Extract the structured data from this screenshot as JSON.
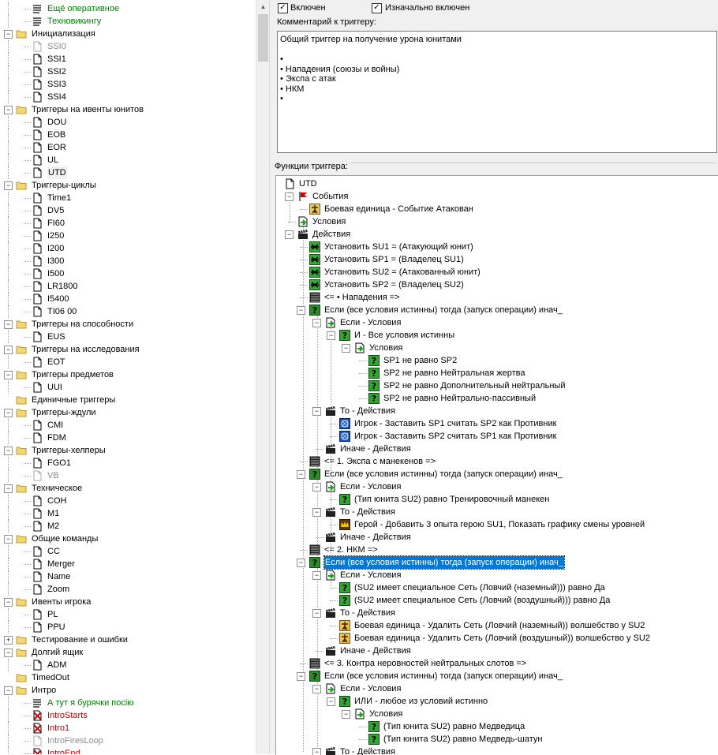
{
  "left_tree": [
    {
      "label": "Ещё оперативное",
      "level": 2,
      "icon": "comment",
      "color": "#008000"
    },
    {
      "label": "Техновикингу",
      "level": 2,
      "icon": "comment",
      "color": "#008000"
    },
    {
      "label": "Инициализация",
      "level": 1,
      "icon": "folder",
      "exp": "-"
    },
    {
      "label": "SSI0",
      "level": 2,
      "icon": "trigger-disabled",
      "color": "#8a8a8a"
    },
    {
      "label": "SSI1",
      "level": 2,
      "icon": "trigger"
    },
    {
      "label": "SSI2",
      "level": 2,
      "icon": "trigger"
    },
    {
      "label": "SSI3",
      "level": 2,
      "icon": "trigger"
    },
    {
      "label": "SSI4",
      "level": 2,
      "icon": "trigger"
    },
    {
      "label": "Триггеры на ивенты юнитов",
      "level": 1,
      "icon": "folder",
      "exp": "-"
    },
    {
      "label": "DOU",
      "level": 2,
      "icon": "trigger"
    },
    {
      "label": "EOB",
      "level": 2,
      "icon": "trigger"
    },
    {
      "label": "EOR",
      "level": 2,
      "icon": "trigger"
    },
    {
      "label": "UL",
      "level": 2,
      "icon": "trigger"
    },
    {
      "label": "UTD",
      "level": 2,
      "icon": "trigger",
      "current": true
    },
    {
      "label": "Триггеры-циклы",
      "level": 1,
      "icon": "folder",
      "exp": "-"
    },
    {
      "label": "Time1",
      "level": 2,
      "icon": "trigger"
    },
    {
      "label": "DV5",
      "level": 2,
      "icon": "trigger"
    },
    {
      "label": "FI60",
      "level": 2,
      "icon": "trigger"
    },
    {
      "label": "I250",
      "level": 2,
      "icon": "trigger"
    },
    {
      "label": "I200",
      "level": 2,
      "icon": "trigger"
    },
    {
      "label": "I300",
      "level": 2,
      "icon": "trigger"
    },
    {
      "label": "I500",
      "level": 2,
      "icon": "trigger"
    },
    {
      "label": "LR1800",
      "level": 2,
      "icon": "trigger"
    },
    {
      "label": "I5400",
      "level": 2,
      "icon": "trigger"
    },
    {
      "label": "TI06 00",
      "level": 2,
      "icon": "trigger"
    },
    {
      "label": "Триггеры на способности",
      "level": 1,
      "icon": "folder",
      "exp": "-"
    },
    {
      "label": "EUS",
      "level": 2,
      "icon": "trigger"
    },
    {
      "label": "Триггеры на исследования",
      "level": 1,
      "icon": "folder",
      "exp": "-"
    },
    {
      "label": "EOT",
      "level": 2,
      "icon": "trigger"
    },
    {
      "label": "Триггеры предметов",
      "level": 1,
      "icon": "folder",
      "exp": "-"
    },
    {
      "label": "UUI",
      "level": 2,
      "icon": "trigger"
    },
    {
      "label": "Единичные триггеры",
      "level": 1,
      "icon": "folder"
    },
    {
      "label": "Триггеры-ждули",
      "level": 1,
      "icon": "folder",
      "exp": "-"
    },
    {
      "label": "CMI",
      "level": 2,
      "icon": "trigger"
    },
    {
      "label": "FDM",
      "level": 2,
      "icon": "trigger"
    },
    {
      "label": "Триггеры-хелперы",
      "level": 1,
      "icon": "folder",
      "exp": "-"
    },
    {
      "label": "FGO1",
      "level": 2,
      "icon": "trigger"
    },
    {
      "label": "VB",
      "level": 2,
      "icon": "trigger-disabled",
      "color": "#8a8a8a"
    },
    {
      "label": "Техническое",
      "level": 1,
      "icon": "folder",
      "exp": "-"
    },
    {
      "label": "COH",
      "level": 2,
      "icon": "trigger"
    },
    {
      "label": "M1",
      "level": 2,
      "icon": "trigger"
    },
    {
      "label": "M2",
      "level": 2,
      "icon": "trigger"
    },
    {
      "label": "Общие команды",
      "level": 1,
      "icon": "folder",
      "exp": "-"
    },
    {
      "label": "CC",
      "level": 2,
      "icon": "trigger"
    },
    {
      "label": "Merger",
      "level": 2,
      "icon": "trigger"
    },
    {
      "label": "Name",
      "level": 2,
      "icon": "trigger"
    },
    {
      "label": "Zoom",
      "level": 2,
      "icon": "trigger"
    },
    {
      "label": "Ивенты игрока",
      "level": 1,
      "icon": "folder",
      "exp": "-"
    },
    {
      "label": "PL",
      "level": 2,
      "icon": "trigger"
    },
    {
      "label": "PPU",
      "level": 2,
      "icon": "trigger"
    },
    {
      "label": "Тестирование и ошибки",
      "level": 1,
      "icon": "folder",
      "exp": "+"
    },
    {
      "label": "Долгий ящик",
      "level": 1,
      "icon": "folder",
      "exp": "-"
    },
    {
      "label": "ADM",
      "level": 2,
      "icon": "trigger"
    },
    {
      "label": "TimedOut",
      "level": 1,
      "icon": "folder"
    },
    {
      "label": "Интро",
      "level": 1,
      "icon": "folder",
      "exp": "-"
    },
    {
      "label": "А тут я бурячки посію",
      "level": 2,
      "icon": "comment",
      "color": "#008000"
    },
    {
      "label": "IntroStarts",
      "level": 2,
      "icon": "trigger-error",
      "color": "#c00000"
    },
    {
      "label": "Intro1",
      "level": 2,
      "icon": "trigger-error",
      "color": "#c00000"
    },
    {
      "label": "IntroFiresLoop",
      "level": 2,
      "icon": "trigger-disabled",
      "color": "#8a8a8a"
    },
    {
      "label": "IntroEnd",
      "level": 2,
      "icon": "trigger-error",
      "color": "#c00000"
    }
  ],
  "settings": {
    "enabled_label": "Включен",
    "initially_enabled_label": "Изначально включен",
    "comment_label": "Комментарий к триггеру:",
    "functions_label": "Функции триггера:"
  },
  "comment_lines": [
    "Общий триггер на получение урона юнитами",
    "",
    "•",
    "• Нападения (союзы и войны)",
    "• Экспа с атак",
    "• НКМ",
    "•"
  ],
  "func_tree": [
    {
      "label": "UTD",
      "level": 0,
      "icon": "trigger-icon"
    },
    {
      "label": "События",
      "level": 1,
      "icon": "event-flag-icon",
      "exp": "-"
    },
    {
      "label": "Боевая единица - Событие Атакован",
      "level": 2,
      "icon": "unit-event-icon"
    },
    {
      "label": "Условия",
      "level": 1,
      "icon": "conditions-icon"
    },
    {
      "label": "Действия",
      "level": 1,
      "icon": "actions-icon",
      "exp": "-"
    },
    {
      "label": "Установить SU1 = (Атакующий юнит)",
      "level": 2,
      "icon": "set-variable-icon"
    },
    {
      "label": "Установить SP1 = (Владелец SU1)",
      "level": 2,
      "icon": "set-variable-icon"
    },
    {
      "label": "Установить SU2 = (Атакованный юнит)",
      "level": 2,
      "icon": "set-variable-icon"
    },
    {
      "label": "Установить SP2 = (Владелец SU2)",
      "level": 2,
      "icon": "set-variable-icon"
    },
    {
      "label": "<= • Нападения =>",
      "level": 2,
      "icon": "comment-icon"
    },
    {
      "label": "Если (все условия истинны) тогда (запуск операции) инач_",
      "level": 2,
      "icon": "if-icon",
      "exp": "-"
    },
    {
      "label": "Если - Условия",
      "level": 3,
      "icon": "conditions-icon",
      "exp": "-"
    },
    {
      "label": "И - Все условия истинны",
      "level": 4,
      "icon": "condition-icon",
      "exp": "-"
    },
    {
      "label": "Условия",
      "level": 5,
      "icon": "conditions-icon",
      "exp": "-"
    },
    {
      "label": "SP1 не равно SP2",
      "level": 6,
      "icon": "condition-icon"
    },
    {
      "label": "SP2 не равно Нейтральная жертва",
      "level": 6,
      "icon": "condition-icon"
    },
    {
      "label": "SP2 не равно Дополнительный нейтральный",
      "level": 6,
      "icon": "condition-icon"
    },
    {
      "label": "SP2 не равно Нейтрально-пассивный",
      "level": 6,
      "icon": "condition-icon"
    },
    {
      "label": "То - Действия",
      "level": 3,
      "icon": "actions-icon",
      "exp": "-"
    },
    {
      "label": "Игрок - Заставить SP1 считать SP2 как Противник",
      "level": 4,
      "icon": "player-icon"
    },
    {
      "label": "Игрок - Заставить SP2 считать SP1 как Противник",
      "level": 4,
      "icon": "player-icon"
    },
    {
      "label": "Иначе - Действия",
      "level": 3,
      "icon": "actions-icon"
    },
    {
      "label": "<= 1. Экспа с манекенов =>",
      "level": 2,
      "icon": "comment-icon"
    },
    {
      "label": "Если (все условия истинны) тогда (запуск операции) инач_",
      "level": 2,
      "icon": "if-icon",
      "exp": "-"
    },
    {
      "label": "Если - Условия",
      "level": 3,
      "icon": "conditions-icon",
      "exp": "-"
    },
    {
      "label": "(Тип юнита SU2) равно Тренировочный манекен",
      "level": 4,
      "icon": "condition-icon"
    },
    {
      "label": "То - Действия",
      "level": 3,
      "icon": "actions-icon",
      "exp": "-"
    },
    {
      "label": "Герой - Добавить 3 опыта герою SU1, Показать графику смены уровней",
      "level": 4,
      "icon": "hero-icon"
    },
    {
      "label": "Иначе - Действия",
      "level": 3,
      "icon": "actions-icon"
    },
    {
      "label": "<= 2. НКМ =>",
      "level": 2,
      "icon": "comment-icon"
    },
    {
      "label": "Если (все условия истинны) тогда (запуск операции) инач_",
      "level": 2,
      "icon": "if-icon",
      "exp": "-",
      "selected": true
    },
    {
      "label": "Если - Условия",
      "level": 3,
      "icon": "conditions-icon",
      "exp": "-"
    },
    {
      "label": "(SU2 имеет специальное Сеть (Ловчий (наземный))) равно Да",
      "level": 4,
      "icon": "condition-icon"
    },
    {
      "label": "(SU2 имеет специальное Сеть (Ловчий (воздушный))) равно Да",
      "level": 4,
      "icon": "condition-icon"
    },
    {
      "label": "То - Действия",
      "level": 3,
      "icon": "actions-icon",
      "exp": "-"
    },
    {
      "label": "Боевая единица - Удалить Сеть (Ловчий (наземный)) волшебство у SU2",
      "level": 4,
      "icon": "unit-action-icon"
    },
    {
      "label": "Боевая единица - Удалить Сеть (Ловчий (воздушный)) волшебство у SU2",
      "level": 4,
      "icon": "unit-action-icon"
    },
    {
      "label": "Иначе - Действия",
      "level": 3,
      "icon": "actions-icon"
    },
    {
      "label": "<= 3. Контра неровностей нейтральных слотов =>",
      "level": 2,
      "icon": "comment-icon"
    },
    {
      "label": "Если (все условия истинны) тогда (запуск операции) инач_",
      "level": 2,
      "icon": "if-icon",
      "exp": "-"
    },
    {
      "label": "Если - Условия",
      "level": 3,
      "icon": "conditions-icon",
      "exp": "-"
    },
    {
      "label": "ИЛИ - любое из условий истинно",
      "level": 4,
      "icon": "condition-icon",
      "exp": "-"
    },
    {
      "label": "Условия",
      "level": 5,
      "icon": "conditions-icon",
      "exp": "-"
    },
    {
      "label": "(Тип юнита SU2) равно Медведица",
      "level": 6,
      "icon": "condition-icon"
    },
    {
      "label": "(Тип юнита SU2) равно Медведь-шатун",
      "level": 6,
      "icon": "condition-icon"
    },
    {
      "label": "То - Действия",
      "level": 3,
      "icon": "actions-icon",
      "exp": "-"
    }
  ]
}
